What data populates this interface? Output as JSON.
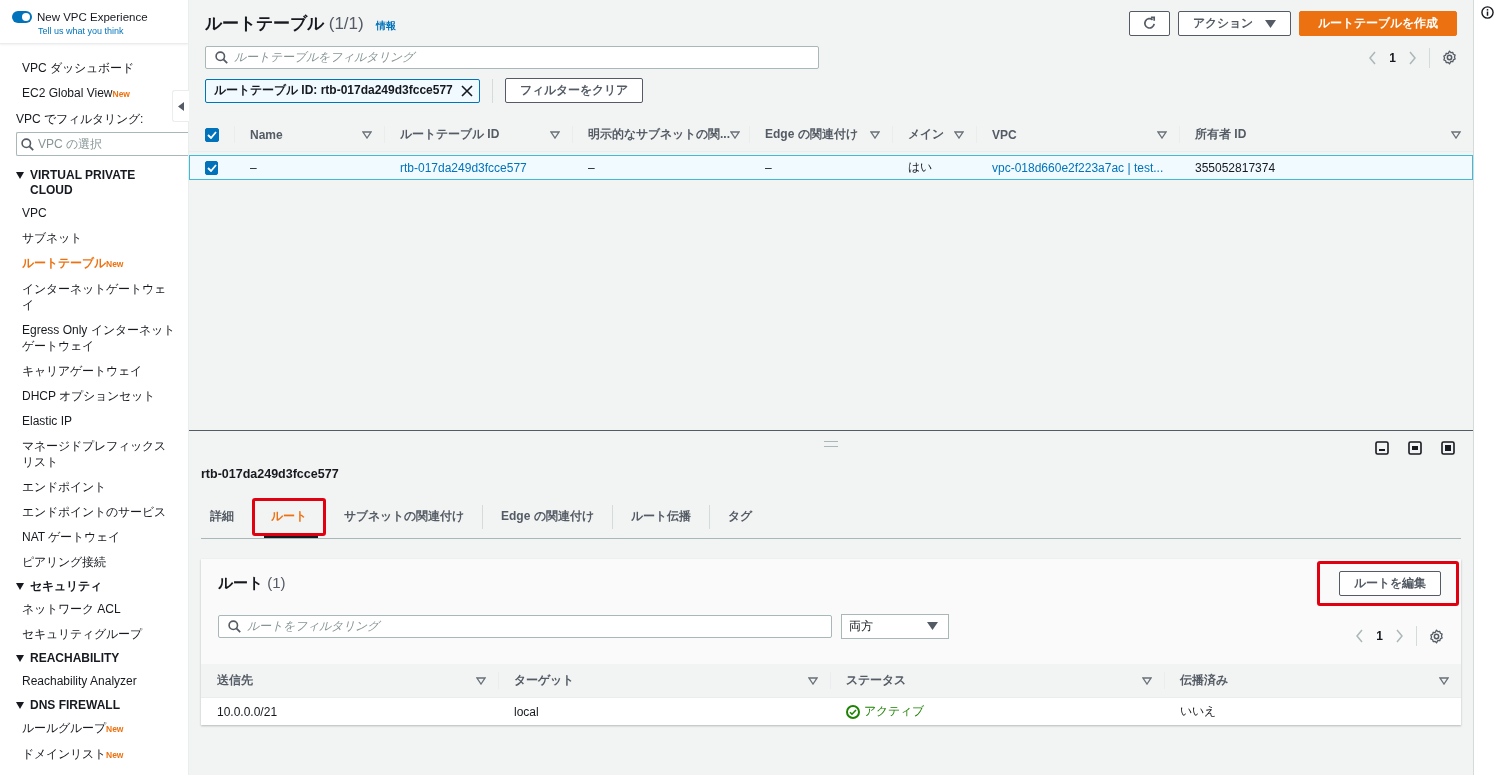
{
  "sidebar": {
    "toggle": {
      "label": "New VPC Experience",
      "on": true,
      "link": "Tell us what you think"
    },
    "top_items": [
      {
        "label": "VPC ダッシュボード",
        "selected": false
      },
      {
        "label": "EC2 Global View",
        "badge": "New",
        "selected": false
      }
    ],
    "filter": {
      "label": "VPC でフィルタリング:",
      "placeholder": "VPC の選択"
    },
    "sections": [
      {
        "title": "VIRTUAL PRIVATE CLOUD",
        "expanded": true,
        "children": [
          {
            "label": "VPC",
            "selected": false
          },
          {
            "label": "サブネット",
            "selected": false
          },
          {
            "label": "ルートテーブル",
            "badge": "New",
            "selected": true
          },
          {
            "label": "インターネットゲートウェイ",
            "selected": false
          },
          {
            "label": "Egress Only インターネットゲートウェイ",
            "selected": false
          },
          {
            "label": "キャリアゲートウェイ",
            "selected": false
          },
          {
            "label": "DHCP オプションセット",
            "selected": false
          },
          {
            "label": "Elastic IP",
            "selected": false
          },
          {
            "label": "マネージドプレフィックスリスト",
            "selected": false
          },
          {
            "label": "エンドポイント",
            "selected": false
          },
          {
            "label": "エンドポイントのサービス",
            "selected": false
          },
          {
            "label": "NAT ゲートウェイ",
            "selected": false
          },
          {
            "label": "ピアリング接続",
            "selected": false
          }
        ]
      },
      {
        "title": "セキュリティ",
        "expanded": true,
        "children": [
          {
            "label": "ネットワーク ACL",
            "selected": false
          },
          {
            "label": "セキュリティグループ",
            "selected": false
          }
        ]
      },
      {
        "title": "REACHABILITY",
        "expanded": true,
        "children": [
          {
            "label": "Reachability Analyzer",
            "selected": false
          }
        ]
      },
      {
        "title": "DNS FIREWALL",
        "expanded": true,
        "children": [
          {
            "label": "ルールグループ",
            "badge": "New",
            "selected": false
          },
          {
            "label": "ドメインリスト",
            "badge": "New",
            "selected": false
          }
        ]
      }
    ]
  },
  "route_tables": {
    "title": "ルートテーブル",
    "count": "(1/1)",
    "info": "情報",
    "actions": {
      "menu": "アクション",
      "create": "ルートテーブルを作成"
    },
    "search": {
      "placeholder": "ルートテーブルをフィルタリング"
    },
    "token": "ルートテーブル ID: rtb-017da249d3fcce577",
    "clear": "フィルターをクリア",
    "page": "1",
    "all_checked": true,
    "columns": [
      "Name",
      "ルートテーブル ID",
      "明示的なサブネットの関...",
      "Edge の関連付け",
      "メイン",
      "VPC",
      "所有者 ID"
    ],
    "rows": [
      {
        "checked": true,
        "selected": true,
        "cells": [
          {
            "kind": "text",
            "text": "–"
          },
          {
            "kind": "link",
            "text": "rtb-017da249d3fcce577"
          },
          {
            "kind": "text",
            "text": "–"
          },
          {
            "kind": "text",
            "text": "–"
          },
          {
            "kind": "text",
            "text": "はい"
          },
          {
            "kind": "link",
            "text": "vpc-018d660e2f223a7ac | test..."
          },
          {
            "kind": "text",
            "text": "355052817374"
          }
        ]
      }
    ]
  },
  "details": {
    "title": "rtb-017da249d3fcce577",
    "tabs": [
      {
        "label": "詳細",
        "selected": false,
        "highlighted": false
      },
      {
        "label": "ルート",
        "selected": true,
        "highlighted": true
      },
      {
        "label": "サブネットの関連付け",
        "selected": false,
        "highlighted": false
      },
      {
        "label": "Edge の関連付け",
        "selected": false,
        "highlighted": false
      },
      {
        "label": "ルート伝播",
        "selected": false,
        "highlighted": false
      },
      {
        "label": "タグ",
        "selected": false,
        "highlighted": false
      }
    ],
    "routes": {
      "title": "ルート",
      "count": "(1)",
      "edit": {
        "label": "ルートを編集",
        "highlighted": true
      },
      "search": {
        "placeholder": "ルートをフィルタリング"
      },
      "select": "両方",
      "page": "1",
      "columns": [
        "送信先",
        "ターゲット",
        "ステータス",
        "伝播済み"
      ],
      "rows": [
        {
          "cells": [
            {
              "kind": "text",
              "text": "10.0.0.0/21"
            },
            {
              "kind": "text",
              "text": "local"
            },
            {
              "kind": "status",
              "text": "アクティブ",
              "color": "#1d8102"
            },
            {
              "kind": "text",
              "text": "いいえ"
            }
          ]
        }
      ]
    }
  }
}
